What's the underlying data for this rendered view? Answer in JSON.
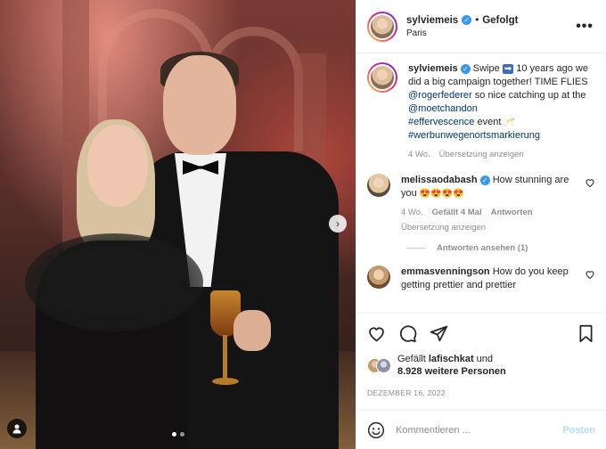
{
  "header": {
    "username": "sylviemeis",
    "separator": "•",
    "follow_state": "Gefolgt",
    "location": "Paris",
    "more_label": "•••"
  },
  "caption": {
    "username": "sylviemeis",
    "text_pre": "Swipe",
    "swipe_emoji": "➡",
    "text_mid": "10 years ago we did a big campaign together! TIME FLIES",
    "mention1": "@rogerfederer",
    "text_mid2": "so nice catching up at the",
    "mention2": "@moetchandon",
    "hashtag1": "#effervescence",
    "text_mid3": "event",
    "event_emoji": "🥂",
    "hashtag2": "#werbunwegenortsmarkierung",
    "time": "4 Wo.",
    "translate": "Übersetzung anzeigen"
  },
  "comments": [
    {
      "username": "melissaodabash",
      "text": "How stunning are you",
      "emojis": "😍😍😍😍",
      "time": "4 Wo.",
      "likes": "Gefällt 4 Mal",
      "reply": "Antworten",
      "translate": "Übersetzung anzeigen",
      "view_replies": "Antworten ansehen (1)"
    },
    {
      "username": "emmasvenningson",
      "text": "How do you keep getting prettier and prettier"
    }
  ],
  "likes": {
    "prefix": "Gefällt",
    "user": "lafischkat",
    "conj": "und",
    "others": "8.928 weitere Personen"
  },
  "date": "DEZEMBER 16, 2022",
  "comment_box": {
    "placeholder": "Kommentieren ...",
    "post_label": "Posten",
    "emoji_icon": "smile-icon"
  },
  "carousel": {
    "next_icon": "›",
    "slides": 2,
    "active_slide": 1
  },
  "colors": {
    "verified": "#3897f0",
    "link": "#00376b",
    "muted": "#8e8e8e",
    "post_disabled": "#b2dffc"
  }
}
